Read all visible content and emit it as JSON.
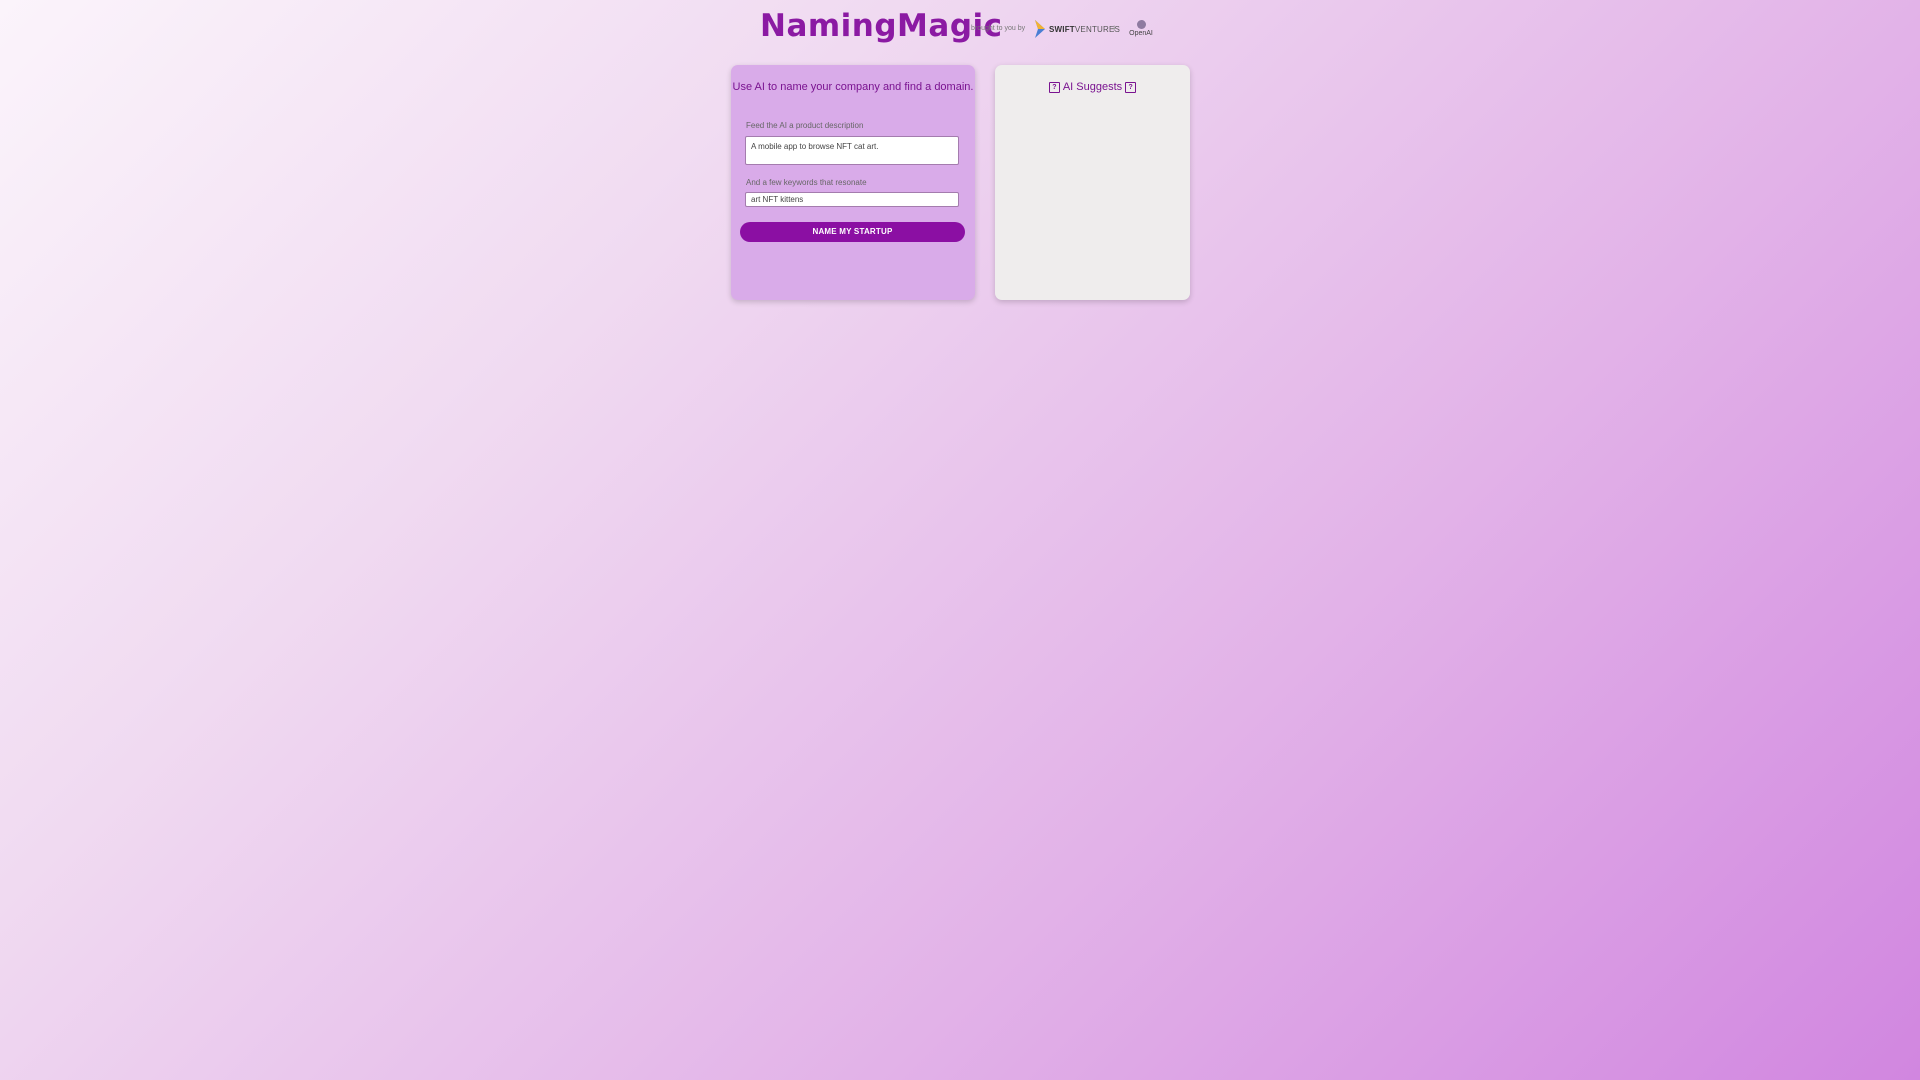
{
  "header": {
    "brand": "NamingMagic",
    "byline": "brought to you by",
    "swift_bold": "SWIFT",
    "swift_rest": "VENTURES",
    "plus": "+",
    "openai": "OpenAI"
  },
  "form": {
    "title": "Use AI to name your company and find a domain.",
    "description_label": "Feed the AI a product description",
    "description_value": "A mobile app to browse NFT cat art.",
    "keywords_label": "And a few keywords that resonate",
    "keywords_value": "art NFT kittens",
    "submit_label": "NAME MY STARTUP"
  },
  "suggestions": {
    "title": "AI Suggests",
    "icon_glyph": "?"
  },
  "colors": {
    "brand": "#8b1aa3",
    "button": "#8b0fa3",
    "left_card": "#d9abe9",
    "right_card": "#efeded"
  }
}
